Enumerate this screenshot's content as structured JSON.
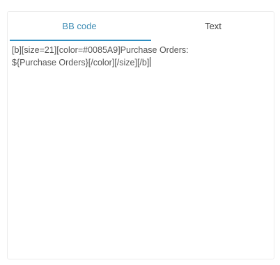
{
  "tabs": [
    {
      "label": "BB code",
      "active": true
    },
    {
      "label": "Text",
      "active": false
    }
  ],
  "editor": {
    "content": "[b][size=21][color=#0085A9]Purchase Orders:\n${Purchase Orders}[/color][/size][/b]"
  },
  "colors": {
    "accent": "#2d8ec2",
    "active_tab_text": "#3f8db5",
    "inactive_tab_text": "#444444",
    "editor_text": "#555555"
  }
}
